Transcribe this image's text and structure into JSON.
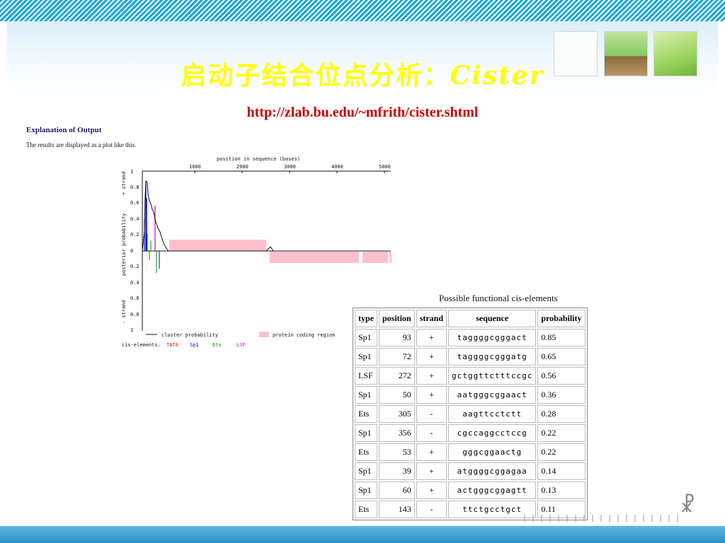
{
  "slide": {
    "title_cn": "启动子结合位点分析：",
    "title_latin": "Cister",
    "url": "http://zlab.bu.edu/~mfrith/cister.shtml",
    "explanation_heading": "Explanation of Output",
    "explanation_text": "The results are displayed as a plot like this."
  },
  "plot": {
    "xaxis_label": "position in sequence (bases)",
    "xticks": [
      "1000",
      "2000",
      "3000",
      "4000",
      "5000"
    ],
    "yaxis_label": "posterior probability",
    "plus_strand_label": "+ strand",
    "minus_strand_label": "- strand",
    "yticks_top": [
      "1",
      "0.8",
      "0.6",
      "0.4",
      "0.2",
      "0"
    ],
    "yticks_bottom": [
      "0.2",
      "0.4",
      "0.6",
      "0.8",
      "1"
    ],
    "legend_line_label": "cluster probability",
    "legend_box_label": "protein coding region",
    "cis_label": "cis-elements:",
    "cis_items": [
      {
        "name": "TATA",
        "color": "#ff0000"
      },
      {
        "name": "Sp1",
        "color": "#0000ff"
      },
      {
        "name": "Ets",
        "color": "#008800"
      },
      {
        "name": "LSF",
        "color": "#cc00cc"
      }
    ],
    "coding_color": "#ffc0cb"
  },
  "table": {
    "caption": "Possible functional cis-elements",
    "headers": [
      "type",
      "position",
      "strand",
      "sequence",
      "probability"
    ],
    "rows": [
      [
        "Sp1",
        "93",
        "+",
        "taggggcgggact",
        "0.85"
      ],
      [
        "Sp1",
        "72",
        "+",
        "taggggcgggatg",
        "0.65"
      ],
      [
        "LSF",
        "272",
        "+",
        "gctggttctttccgc",
        "0.56"
      ],
      [
        "Sp1",
        "50",
        "+",
        "aatgggcggaact",
        "0.36"
      ],
      [
        "Ets",
        "305",
        "-",
        "aagttcctctt",
        "0.28"
      ],
      [
        "Sp1",
        "356",
        "-",
        "cgccaggcctccg",
        "0.22"
      ],
      [
        "Ets",
        "53",
        "+",
        "gggcggaactg",
        "0.22"
      ],
      [
        "Sp1",
        "39",
        "+",
        "atggggcggagaa",
        "0.14"
      ],
      [
        "Sp1",
        "60",
        "+",
        "actgggcggagtt",
        "0.13"
      ],
      [
        "Ets",
        "143",
        "-",
        "ttctgcctgct",
        "0.11"
      ]
    ]
  },
  "colors": {
    "title": "#ffff00",
    "url": "#cc0000",
    "accent": "#1aa6d9"
  }
}
